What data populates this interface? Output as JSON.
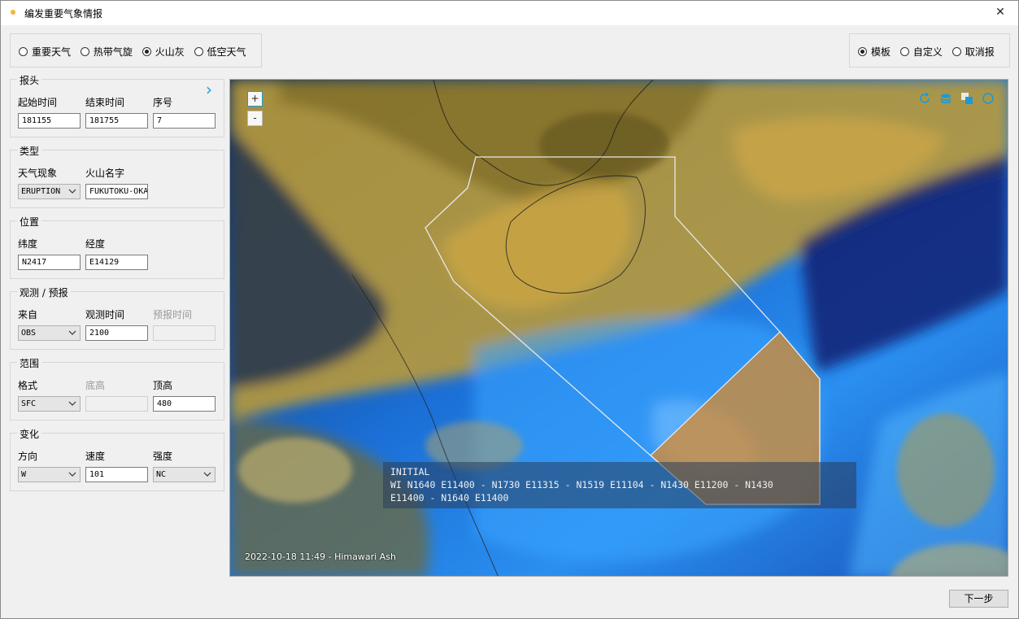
{
  "window": {
    "title": "编发重要气象情报",
    "close_glyph": "✕"
  },
  "type_options": [
    {
      "label": "重要天气",
      "selected": false
    },
    {
      "label": "热带气旋",
      "selected": false
    },
    {
      "label": "火山灰",
      "selected": true
    },
    {
      "label": "低空天气",
      "selected": false
    }
  ],
  "mode_options": [
    {
      "label": "模板",
      "selected": true
    },
    {
      "label": "自定义",
      "selected": false
    },
    {
      "label": "取消报",
      "selected": false
    }
  ],
  "header": {
    "legend": "报头",
    "expand_glyph": "›",
    "start_label": "起始时间",
    "start_value": "181155",
    "end_label": "结束时间",
    "end_value": "181755",
    "seq_label": "序号",
    "seq_value": "7"
  },
  "category": {
    "legend": "类型",
    "phenomenon_label": "天气现象",
    "phenomenon_value": "ERUPTION",
    "volcano_label": "火山名字",
    "volcano_value": "FUKUTOKU-OKA-NO-BA"
  },
  "position": {
    "legend": "位置",
    "lat_label": "纬度",
    "lat_value": "N2417",
    "lon_label": "经度",
    "lon_value": "E14129"
  },
  "observation": {
    "legend": "观测 / 预报",
    "source_label": "来自",
    "source_value": "OBS",
    "obs_time_label": "观测时间",
    "obs_time_value": "2100",
    "fcst_time_label": "预报时间",
    "fcst_time_value": ""
  },
  "range": {
    "legend": "范围",
    "format_label": "格式",
    "format_value": "SFC",
    "base_label": "底高",
    "base_value": "",
    "top_label": "顶高",
    "top_value": "480"
  },
  "change": {
    "legend": "变化",
    "direction_label": "方向",
    "direction_value": "W",
    "speed_label": "速度",
    "speed_value": "101",
    "intensity_label": "强度",
    "intensity_value": "NC"
  },
  "map": {
    "zoom_in": "+",
    "zoom_out": "-",
    "info_line1": "INITIAL",
    "info_line2": "WI N1640 E11400 - N1730 E11315 - N1519 E11104 - N1430 E11200 - N1430",
    "info_line3": "E11400 - N1640 E11400",
    "timestamp": "2022-10-18 11:49 - Himawari Ash",
    "tools": [
      "refresh-icon",
      "layers-icon",
      "copy-icon",
      "circle-icon"
    ],
    "accent_color": "#1a9bd7"
  },
  "footer": {
    "next_label": "下一步"
  }
}
